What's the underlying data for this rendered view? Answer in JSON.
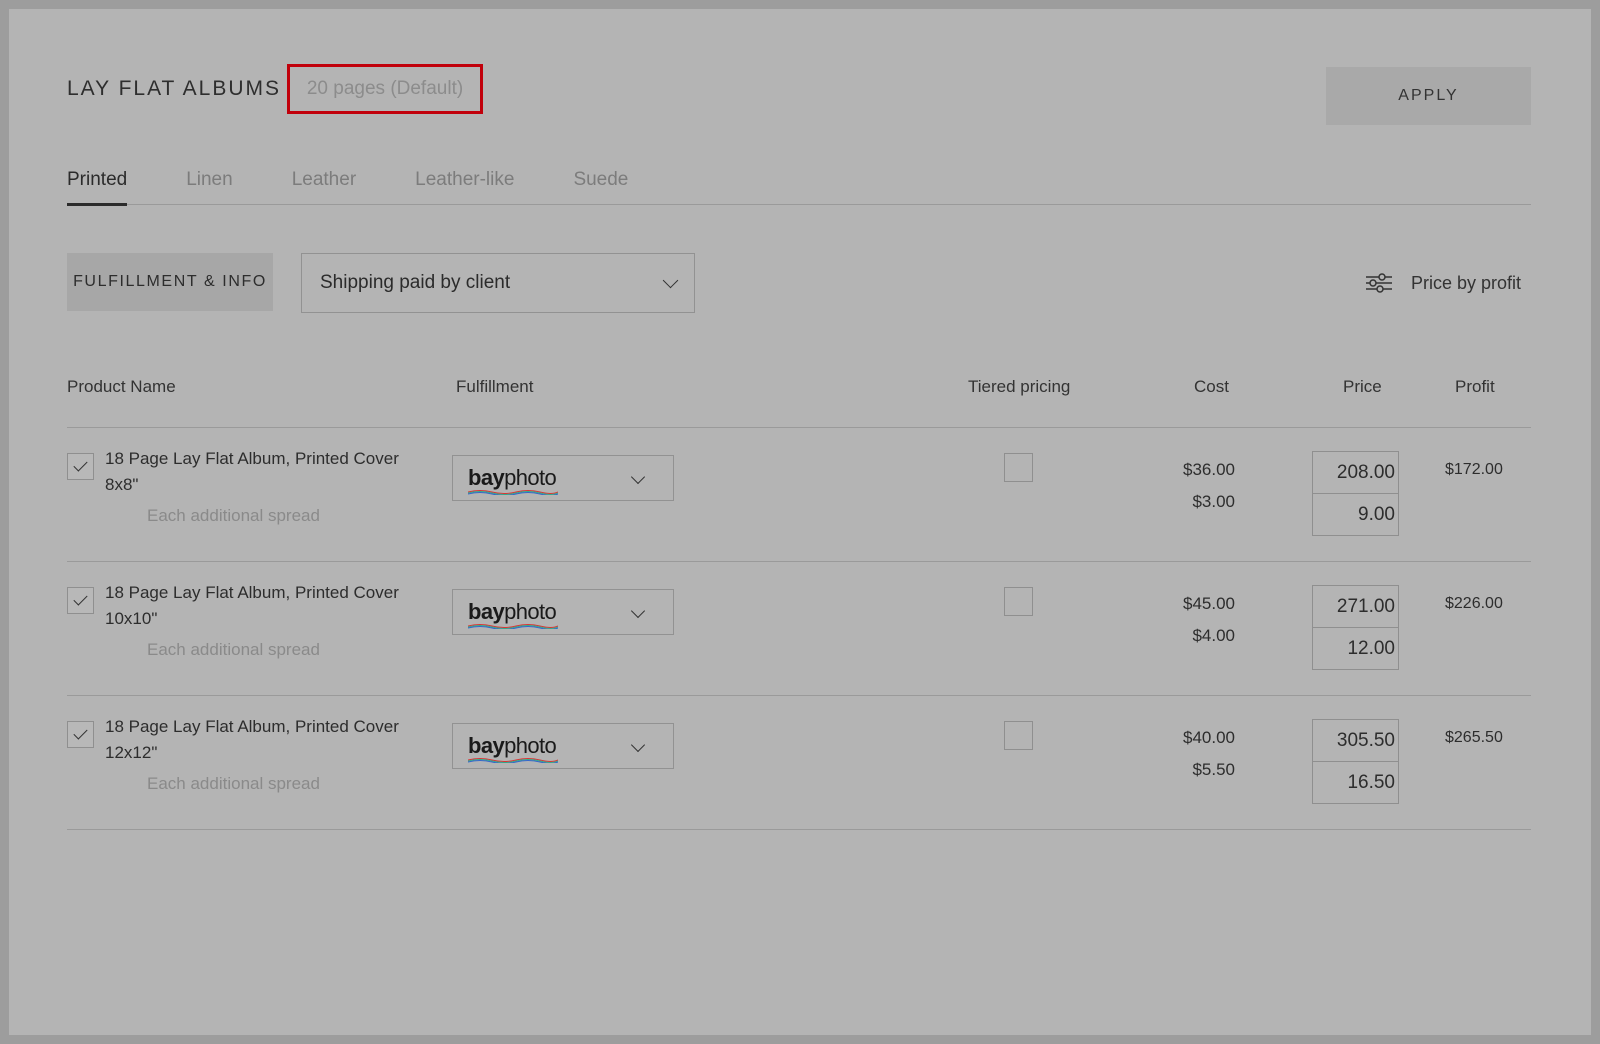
{
  "header": {
    "title": "LAY FLAT ALBUMS",
    "pages_select": "20 pages (Default)",
    "apply_label": "APPLY",
    "highlight_color": "#c1000b"
  },
  "tabs": [
    {
      "label": "Printed",
      "active": true
    },
    {
      "label": "Linen",
      "active": false
    },
    {
      "label": "Leather",
      "active": false
    },
    {
      "label": "Leather-like",
      "active": false
    },
    {
      "label": "Suede",
      "active": false
    }
  ],
  "toolbar": {
    "fulfillment_info_label": "FULFILLMENT & INFO",
    "shipping_select": "Shipping paid by client",
    "price_by_profit_label": "Price by profit",
    "price_by_profit_icon": "sliders-icon"
  },
  "table": {
    "columns": [
      "Product Name",
      "Fulfillment",
      "Tiered pricing",
      "Cost",
      "Price",
      "Profit"
    ],
    "rows": [
      {
        "checked": true,
        "name": "18 Page Lay Flat Album, Printed Cover 8x8\"",
        "sub": "Each additional spread",
        "fulfillment": "bayphoto",
        "tiered": false,
        "cost": "$36.00",
        "cost_additional": "$3.00",
        "price": "208.00",
        "price_additional": "9.00",
        "profit": "$172.00"
      },
      {
        "checked": true,
        "name": "18 Page Lay Flat Album, Printed Cover 10x10\"",
        "sub": "Each additional spread",
        "fulfillment": "bayphoto",
        "tiered": false,
        "cost": "$45.00",
        "cost_additional": "$4.00",
        "price": "271.00",
        "price_additional": "12.00",
        "profit": "$226.00"
      },
      {
        "checked": true,
        "name": "18 Page Lay Flat Album, Printed Cover 12x12\"",
        "sub": "Each additional spread",
        "fulfillment": "bayphoto",
        "tiered": false,
        "cost": "$40.00",
        "cost_additional": "$5.50",
        "price": "305.50",
        "price_additional": "16.50",
        "profit": "$265.50"
      }
    ]
  }
}
